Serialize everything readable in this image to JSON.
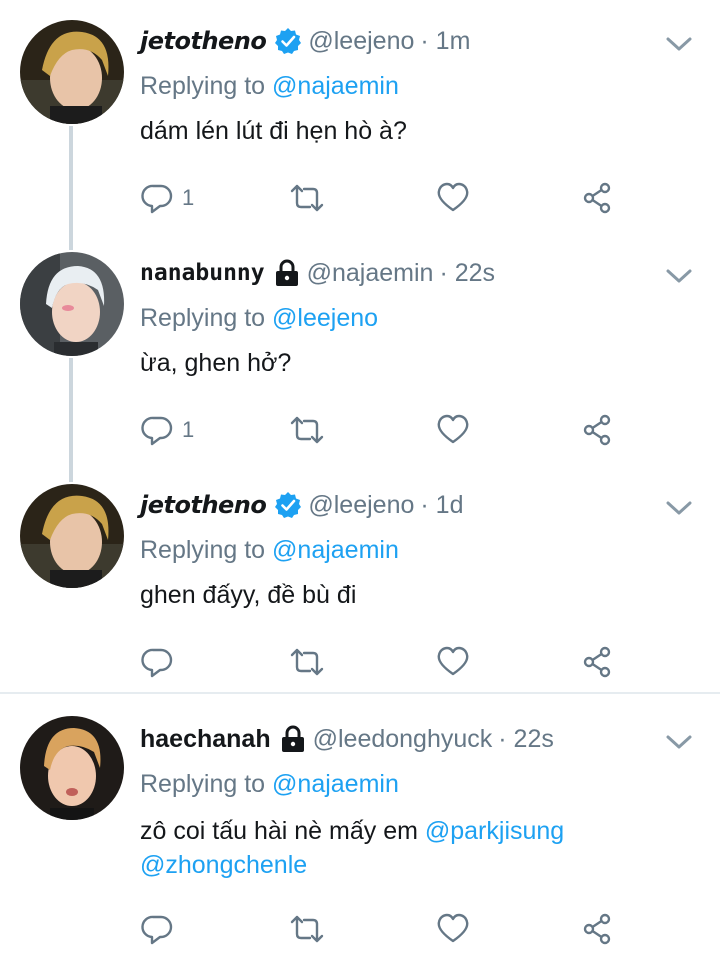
{
  "colors": {
    "accent": "#1da1f2",
    "muted": "#657786",
    "text": "#14171a",
    "thread_line": "#ccd6dd"
  },
  "icons": [
    "verified-badge-icon",
    "lock-icon",
    "chevron-down-icon",
    "reply-icon",
    "retweet-icon",
    "like-icon",
    "share-icon"
  ],
  "tweets": [
    {
      "display_name": "jetotheno",
      "handle": "@leejeno",
      "time": "· 1m",
      "replying_prefix": "Replying to",
      "replying_to": "@najaemin",
      "text": "dám lén lút đi hẹn hò à?",
      "reply_count": "1",
      "badge": "verified"
    },
    {
      "display_name": "nanabunny",
      "handle": "@najaemin",
      "time": "· 22s",
      "replying_prefix": "Replying to",
      "replying_to": "@leejeno",
      "text": "ừa, ghen hở?",
      "reply_count": "1",
      "badge": "lock"
    },
    {
      "display_name": "jetotheno",
      "handle": "@leejeno",
      "time": "· 1d",
      "replying_prefix": "Replying to",
      "replying_to": "@najaemin",
      "text": "ghen đấyy, đề bù đi",
      "reply_count": "",
      "badge": "verified"
    },
    {
      "display_name": "haechanah",
      "handle": "@leedonghyuck",
      "time": "· 22s",
      "replying_prefix": "Replying to",
      "replying_to": "@najaemin",
      "text": "zô coi tấu hài nè mấy em",
      "text_mention_1": "@parkjisung",
      "text_mention_2": "@zhongchenle",
      "reply_count": "",
      "badge": "lock"
    }
  ]
}
